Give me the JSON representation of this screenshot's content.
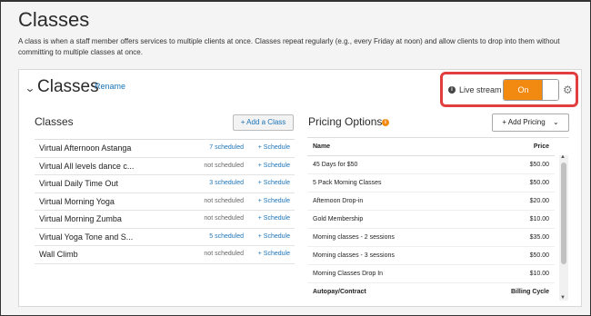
{
  "page": {
    "title": "Classes",
    "description": "A class is when a staff member offers services to multiple clients at once. Classes repeat regularly (e.g., every Friday at noon) and allow clients to drop into them without committing to multiple classes at once."
  },
  "card": {
    "title": "Classes",
    "rename_label": "Rename",
    "live_stream": {
      "label": "Live stream",
      "toggle_state": "On",
      "icon": "info-icon"
    },
    "settings_icon": "gear-icon"
  },
  "classes": {
    "title": "Classes",
    "add_label": "+ Add a Class",
    "items": [
      {
        "name": "Virtual Afternoon Astanga",
        "status": "7 scheduled",
        "scheduled": true,
        "action": "+ Schedule"
      },
      {
        "name": "Virtual All levels dance c...",
        "status": "not scheduled",
        "scheduled": false,
        "action": "+ Schedule"
      },
      {
        "name": "Virtual Daily Time Out",
        "status": "3 scheduled",
        "scheduled": true,
        "action": "+ Schedule"
      },
      {
        "name": "Virtual Morning Yoga",
        "status": "not scheduled",
        "scheduled": false,
        "action": "+ Schedule"
      },
      {
        "name": "Virtual Morning Zumba",
        "status": "not scheduled",
        "scheduled": false,
        "action": "+ Schedule"
      },
      {
        "name": "Virtual Yoga Tone and S...",
        "status": "5 scheduled",
        "scheduled": true,
        "action": "+ Schedule"
      },
      {
        "name": "Wall Climb",
        "status": "not scheduled",
        "scheduled": false,
        "action": "+ Schedule"
      }
    ]
  },
  "pricing": {
    "title": "Pricing Options",
    "add_label": "+ Add Pricing",
    "columns": {
      "name": "Name",
      "price": "Price"
    },
    "rows": [
      {
        "name": "45 Days for $50",
        "price": "$50.00"
      },
      {
        "name": "5 Pack Morning Classes",
        "price": "$50.00"
      },
      {
        "name": "Afternoon Drop-in",
        "price": "$20.00"
      },
      {
        "name": "Gold Membership",
        "price": "$10.00"
      },
      {
        "name": "Morning classes - 2 sessions",
        "price": "$35.00"
      },
      {
        "name": "Morning classes - 3 sessions",
        "price": "$50.00"
      },
      {
        "name": "Morning Classes Drop In",
        "price": "$10.00"
      }
    ],
    "footer": {
      "name": "Autopay/Contract",
      "price": "Billing Cycle"
    }
  },
  "colors": {
    "accent": "#f28a12",
    "link": "#1a73b8",
    "highlight_border": "#e33e3e"
  }
}
